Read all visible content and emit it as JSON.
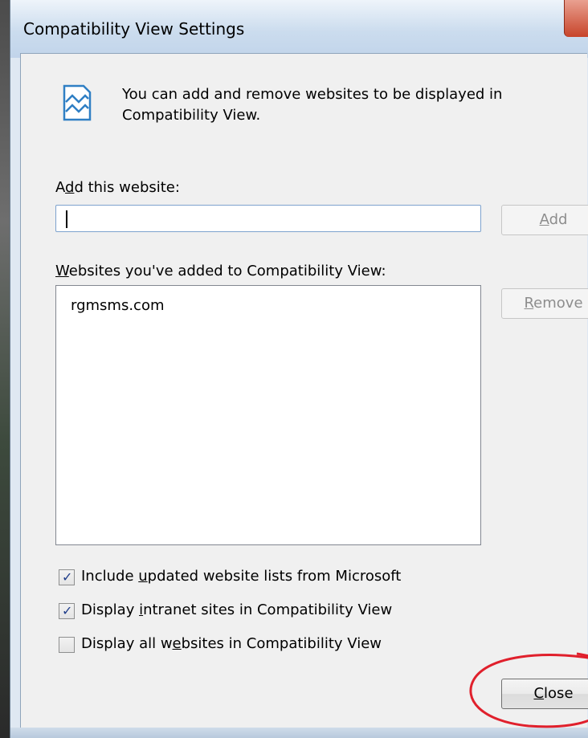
{
  "window": {
    "title": "Compatibility View Settings"
  },
  "info": {
    "text": "You can add and remove websites to be displayed in Compatibility View."
  },
  "add_section": {
    "label_pre": "A",
    "label_ul": "d",
    "label_post": "d this website:",
    "input_value": "",
    "add_button": {
      "ul": "A",
      "rest": "dd"
    }
  },
  "list_section": {
    "label_ul": "W",
    "label_post": "ebsites you've added to Compatibility View:",
    "items": [
      "rgmsms.com"
    ],
    "remove_button": {
      "ul": "R",
      "rest": "emove"
    }
  },
  "options": [
    {
      "pre": "Include ",
      "ul": "u",
      "post": "pdated website lists from Microsoft",
      "checked": true
    },
    {
      "pre": "Display ",
      "ul": "i",
      "post": "ntranet sites in Compatibility View",
      "checked": true
    },
    {
      "pre": "Display all w",
      "ul": "e",
      "post": "bsites in Compatibility View",
      "checked": false
    }
  ],
  "close_button": {
    "ul": "C",
    "rest": "lose"
  },
  "colors": {
    "annotation": "#e0202c",
    "title_bar": "#c8daee",
    "dialog_bg": "#f0f0f0"
  }
}
